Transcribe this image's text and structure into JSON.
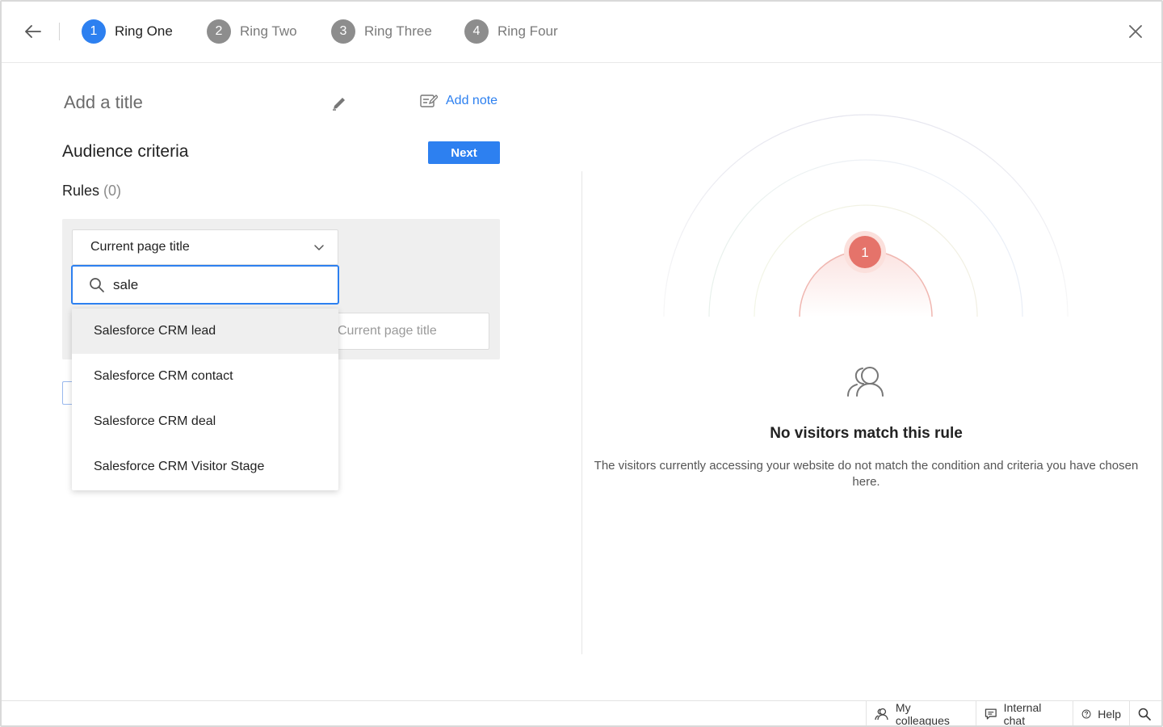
{
  "steps": [
    {
      "number": "1",
      "label": "Ring One",
      "active": true
    },
    {
      "number": "2",
      "label": "Ring Two",
      "active": false
    },
    {
      "number": "3",
      "label": "Ring Three",
      "active": false
    },
    {
      "number": "4",
      "label": "Ring Four",
      "active": false
    }
  ],
  "header": {
    "title_placeholder": "Add a title",
    "add_note": "Add note"
  },
  "criteria": {
    "section_title": "Audience criteria",
    "next_label": "Next",
    "rules_label": "Rules",
    "rules_count": "(0)"
  },
  "rule": {
    "selected_field": "Current page title",
    "search_value": "sale",
    "value_placeholder": "Current page title"
  },
  "dropdown": {
    "items": [
      "Salesforce CRM lead",
      "Salesforce CRM contact",
      "Salesforce CRM deal",
      "Salesforce CRM Visitor Stage"
    ],
    "highlighted_index": 0
  },
  "visualization": {
    "ring_badge": "1"
  },
  "empty_state": {
    "title": "No visitors match this rule",
    "description": "The visitors currently accessing your website do not match the condition and criteria you have chosen here."
  },
  "bottom_bar": {
    "colleagues": "My colleagues",
    "chat": "Internal chat",
    "help": "Help"
  },
  "colors": {
    "accent": "#2d80f0",
    "ring_badge": "#e5736a"
  }
}
